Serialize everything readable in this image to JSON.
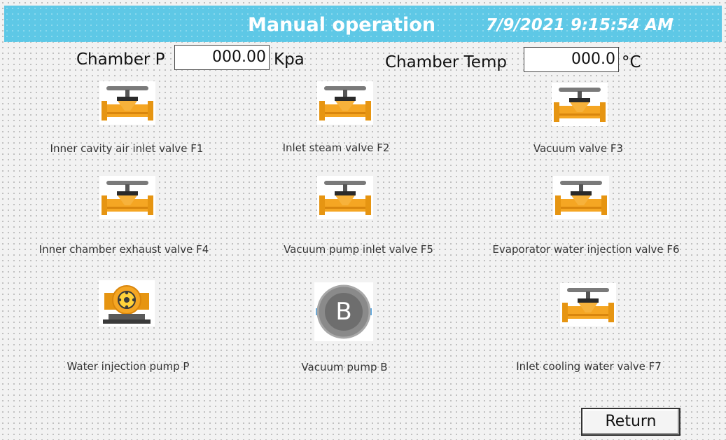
{
  "header": {
    "title": "Manual operation",
    "datetime": "7/9/2021 9:15:54 AM",
    "background_color": "#5ec8e6"
  },
  "readouts": {
    "chamber_p": {
      "label": "Chamber P",
      "value": "000.00",
      "unit": "Kpa"
    },
    "chamber_temp": {
      "label": "Chamber Temp",
      "value": "000.0",
      "unit": "°C"
    }
  },
  "devices": [
    {
      "label": "Inner cavity air inlet valve F1",
      "icon": "valve-icon"
    },
    {
      "label": "Inlet steam valve F2",
      "icon": "valve-icon"
    },
    {
      "label": "Vacuum valve F3",
      "icon": "valve-icon"
    },
    {
      "label": "Inner chamber exhaust valve F4",
      "icon": "valve-icon"
    },
    {
      "label": "Vacuum pump inlet valve F5",
      "icon": "valve-icon"
    },
    {
      "label": "Evaporator water injection valve F6",
      "icon": "valve-icon"
    },
    {
      "label": "Water injection pump P",
      "icon": "pump-icon"
    },
    {
      "label": "Vacuum pump B",
      "icon": "vacuum-pump-icon",
      "badge": "B"
    },
    {
      "label": "Inlet cooling water valve F7",
      "icon": "valve-icon"
    }
  ],
  "buttons": {
    "return_label": "Return"
  },
  "colors": {
    "valve": "#f5a623",
    "valve_handle": "#7a7a7a"
  }
}
